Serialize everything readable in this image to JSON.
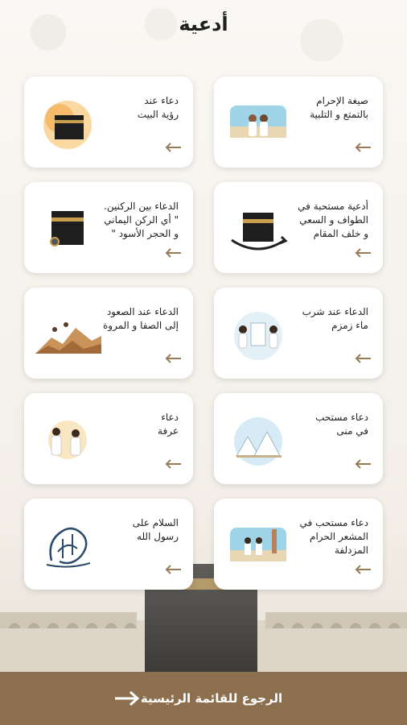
{
  "header": {
    "title": "أدعية"
  },
  "cards": [
    {
      "text": "صيغة الإحرام\nبالتمتع و التلبية",
      "icon": "ihram-pilgrims-icon"
    },
    {
      "text": "دعاء عند\nرؤية البيت",
      "icon": "kaaba-watercolor-icon"
    },
    {
      "text": "أدعية مستحبة في\nالطواف و السعي\nو خلف المقام",
      "icon": "kaaba-tawaf-icon"
    },
    {
      "text": "الدعاء بين الركنين.\n\" أي الركن اليماني\nو الحجر الأسود \"",
      "icon": "kaaba-corner-icon"
    },
    {
      "text": "الدعاء عند شرب\nماء زمزم",
      "icon": "zamzam-icon"
    },
    {
      "text": "الدعاء عند الصعود\nإلى الصفا و المروة",
      "icon": "safa-marwa-icon"
    },
    {
      "text": "دعاء مستحب\nفي منى",
      "icon": "mina-tents-icon"
    },
    {
      "text": "دعاء\nعرفة",
      "icon": "arafah-icon"
    },
    {
      "text": "دعاء مستحب في\nالمشعر الحرام\nالمزدلفة",
      "icon": "muzdalifah-icon"
    },
    {
      "text": "السلام على\nرسول الله",
      "icon": "calligraphy-icon"
    }
  ],
  "footer": {
    "label": "الرجوع للقائمة الرئيسية"
  },
  "colors": {
    "accent": "#8c6f4f",
    "arrow": "#9a7b58"
  }
}
